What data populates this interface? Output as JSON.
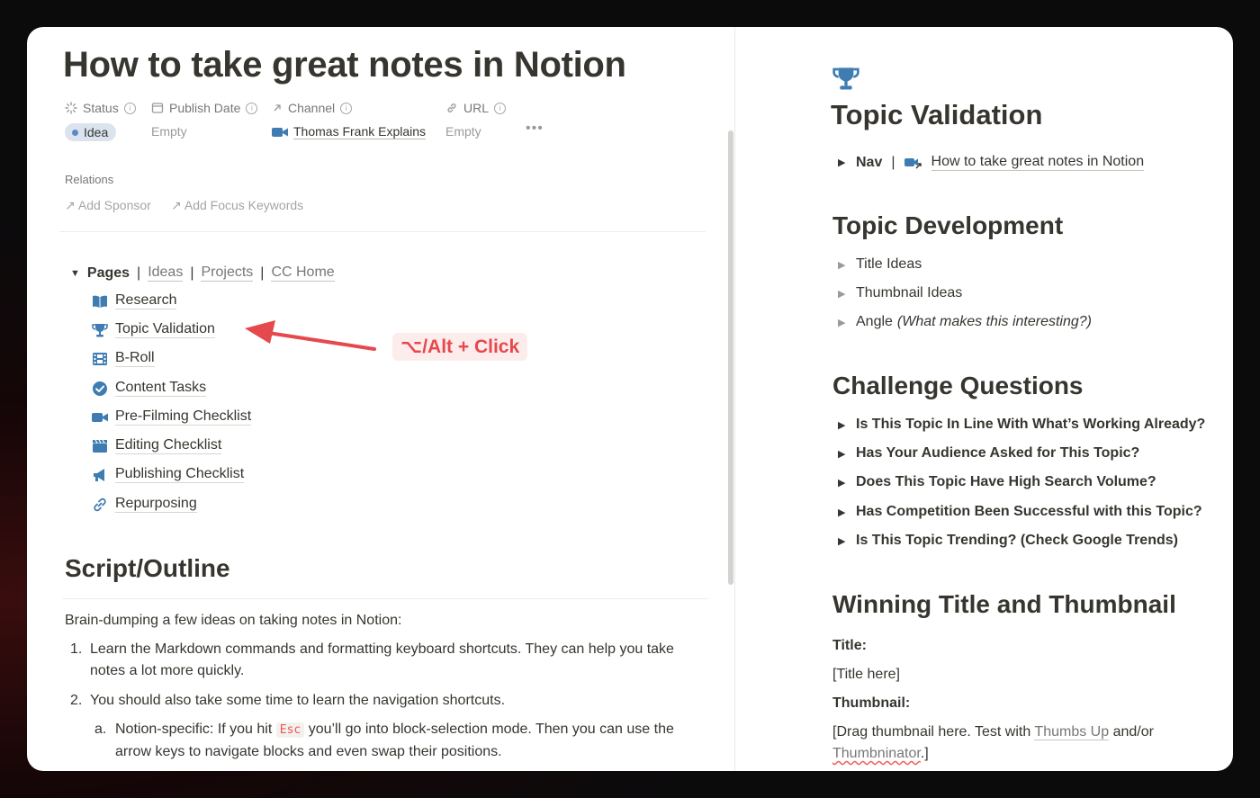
{
  "left": {
    "title": "How to take great notes in Notion",
    "properties": {
      "status_label": "Status",
      "status_value": "Idea",
      "publish_date_label": "Publish Date",
      "publish_date_value": "Empty",
      "channel_label": "Channel",
      "channel_value": "Thomas Frank Explains",
      "url_label": "URL",
      "url_value": "Empty",
      "more": "•••"
    },
    "relations": {
      "label": "Relations",
      "add_sponsor": "Add Sponsor",
      "add_focus_keywords": "Add Focus Keywords"
    },
    "pages_nav": {
      "label": "Pages",
      "links": [
        "Ideas",
        "Projects",
        "CC Home"
      ],
      "separator": "|"
    },
    "page_items": [
      {
        "label": "Research",
        "icon": "book-icon"
      },
      {
        "label": "Topic Validation",
        "icon": "trophy-icon"
      },
      {
        "label": "B-Roll",
        "icon": "film-icon"
      },
      {
        "label": "Content Tasks",
        "icon": "check-circle-icon"
      },
      {
        "label": "Pre-Filming Checklist",
        "icon": "video-camera-icon"
      },
      {
        "label": "Editing Checklist",
        "icon": "clapperboard-icon"
      },
      {
        "label": "Publishing Checklist",
        "icon": "megaphone-icon"
      },
      {
        "label": "Repurposing",
        "icon": "link-icon"
      }
    ],
    "annotation": "⌥/Alt + Click",
    "script_heading": "Script/Outline",
    "intro": "Brain-dumping a few ideas on taking notes in Notion:",
    "list": {
      "item1_num": "1.",
      "item1": "Learn the Markdown commands and formatting keyboard shortcuts. They can help you take notes a lot more quickly.",
      "item2_num": "2.",
      "item2": "You should also take some time to learn the navigation shortcuts.",
      "sub_a_num": "a.",
      "sub_a_before": "Notion-specific: If you hit",
      "sub_a_code": "Esc",
      "sub_a_after": "you’ll go into block-selection mode. Then you can use the arrow keys to navigate blocks and even swap their positions."
    }
  },
  "right": {
    "title": "Topic Validation",
    "nav": {
      "label": "Nav",
      "separator": "|",
      "link": "How to take great notes in Notion"
    },
    "topic_development": {
      "heading": "Topic Development",
      "items": [
        "Title Ideas",
        "Thumbnail Ideas",
        "Angle"
      ],
      "angle_note": "(What makes this interesting?)"
    },
    "challenge_questions": {
      "heading": "Challenge Questions",
      "items": [
        "Is This Topic In Line With What’s Working Already?",
        "Has Your Audience Asked for This Topic?",
        "Does This Topic Have High Search Volume?",
        "Has Competition Been Successful with this Topic?",
        "Is This Topic Trending? (Check Google Trends)"
      ]
    },
    "winning": {
      "heading": "Winning Title and Thumbnail",
      "title_label": "Title:",
      "title_value": "[Title here]",
      "thumbnail_label": "Thumbnail:",
      "thumb_text_1": "[Drag thumbnail here. Test with",
      "thumb_link_1": "Thumbs Up",
      "thumb_text_2": "and/or",
      "thumb_link_2": "Thumbninator",
      "thumb_text_3": ".]"
    }
  },
  "colors": {
    "accent_blue": "#3e7cb1",
    "annotation_red": "#e5484d",
    "text": "#37352f"
  }
}
